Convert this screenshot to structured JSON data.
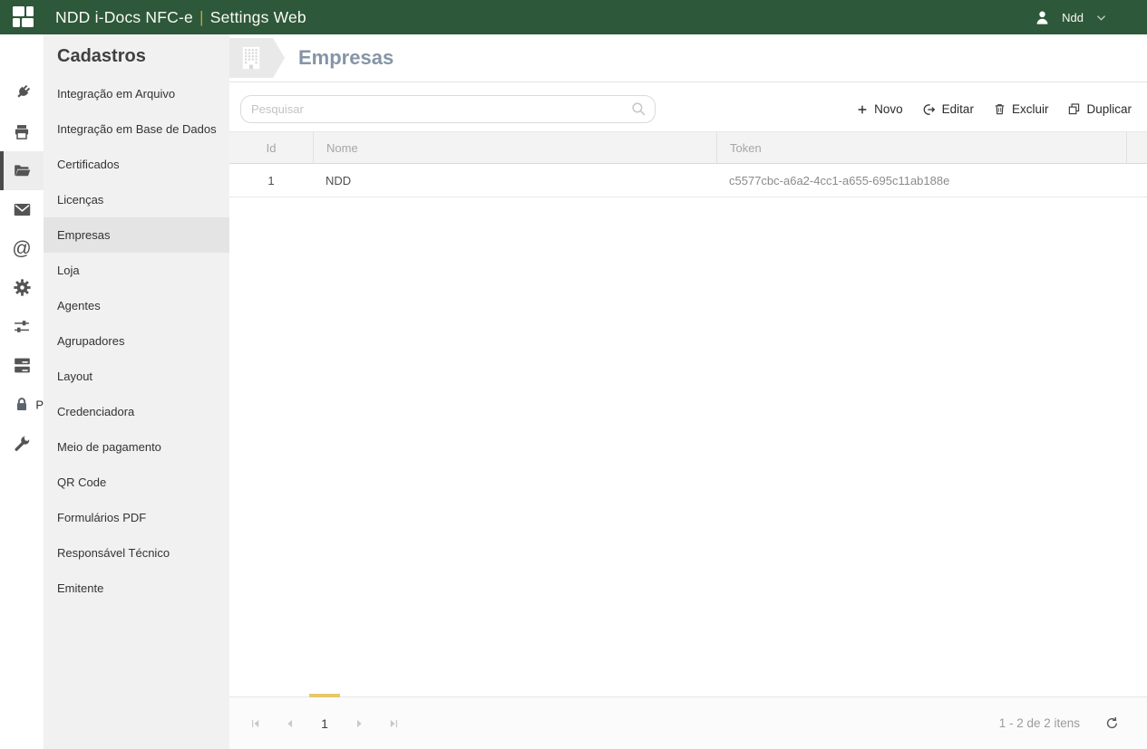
{
  "topbar": {
    "app_title_left": "NDD i-Docs NFC-e",
    "app_title_separator": "|",
    "app_title_right": "Settings Web",
    "user_name": "Ndd"
  },
  "icon_strip": {
    "icons": [
      "plug-icon",
      "printer-icon",
      "folder-open-icon",
      "envelope-icon",
      "at-sign-icon",
      "gear-icon",
      "sliders-icon",
      "server-stack-icon",
      "lock-icon",
      "wrench-icon"
    ],
    "active_icon": "folder-open-icon",
    "peek_text": "P"
  },
  "sidebar": {
    "heading": "Cadastros",
    "items": [
      {
        "id": "integracao-em-arquivo",
        "label": "Integração em Arquivo",
        "active": false
      },
      {
        "id": "integracao-em-base-de-dados",
        "label": "Integração em Base de Dados",
        "active": false
      },
      {
        "id": "certificados",
        "label": "Certificados",
        "active": false
      },
      {
        "id": "licencas",
        "label": "Licenças",
        "active": false
      },
      {
        "id": "empresas",
        "label": "Empresas",
        "active": true
      },
      {
        "id": "loja",
        "label": "Loja",
        "active": false
      },
      {
        "id": "agentes",
        "label": "Agentes",
        "active": false
      },
      {
        "id": "agrupadores",
        "label": "Agrupadores",
        "active": false
      },
      {
        "id": "layout",
        "label": "Layout",
        "active": false
      },
      {
        "id": "credenciadora",
        "label": "Credenciadora",
        "active": false
      },
      {
        "id": "meio-de-pagamento",
        "label": "Meio de pagamento",
        "active": false
      },
      {
        "id": "qr-code",
        "label": "QR Code",
        "active": false
      },
      {
        "id": "formularios-pdf",
        "label": "Formulários PDF",
        "active": false
      },
      {
        "id": "responsavel-tecnico",
        "label": "Responsável Técnico",
        "active": false
      },
      {
        "id": "emitente",
        "label": "Emitente",
        "active": false
      }
    ]
  },
  "page": {
    "title": "Empresas",
    "search_placeholder": "Pesquisar",
    "actions": [
      {
        "id": "novo",
        "label": "Novo"
      },
      {
        "id": "editar",
        "label": "Editar"
      },
      {
        "id": "excluir",
        "label": "Excluir"
      },
      {
        "id": "duplicar",
        "label": "Duplicar"
      }
    ]
  },
  "table": {
    "columns": [
      "Id",
      "Nome",
      "Token"
    ],
    "rows": [
      {
        "id": "1",
        "nome": "NDD",
        "token": "c5577cbc-a6a2-4cc1-a655-695c11ab188e"
      }
    ]
  },
  "pagination": {
    "current_page": "1",
    "items_label": "1 - 2 de 2 itens"
  },
  "colors": {
    "topbar_green": "#2d5839",
    "title_separator_gold": "#c3a33b",
    "pager_indicator_gold": "#e5c96b",
    "page_title_blue_gray": "#8595a6",
    "sidebar_bg": "#f1f1f1",
    "sidebar_active_bg": "#e4e4e4",
    "grid_header_bg": "#f3f3f3"
  }
}
